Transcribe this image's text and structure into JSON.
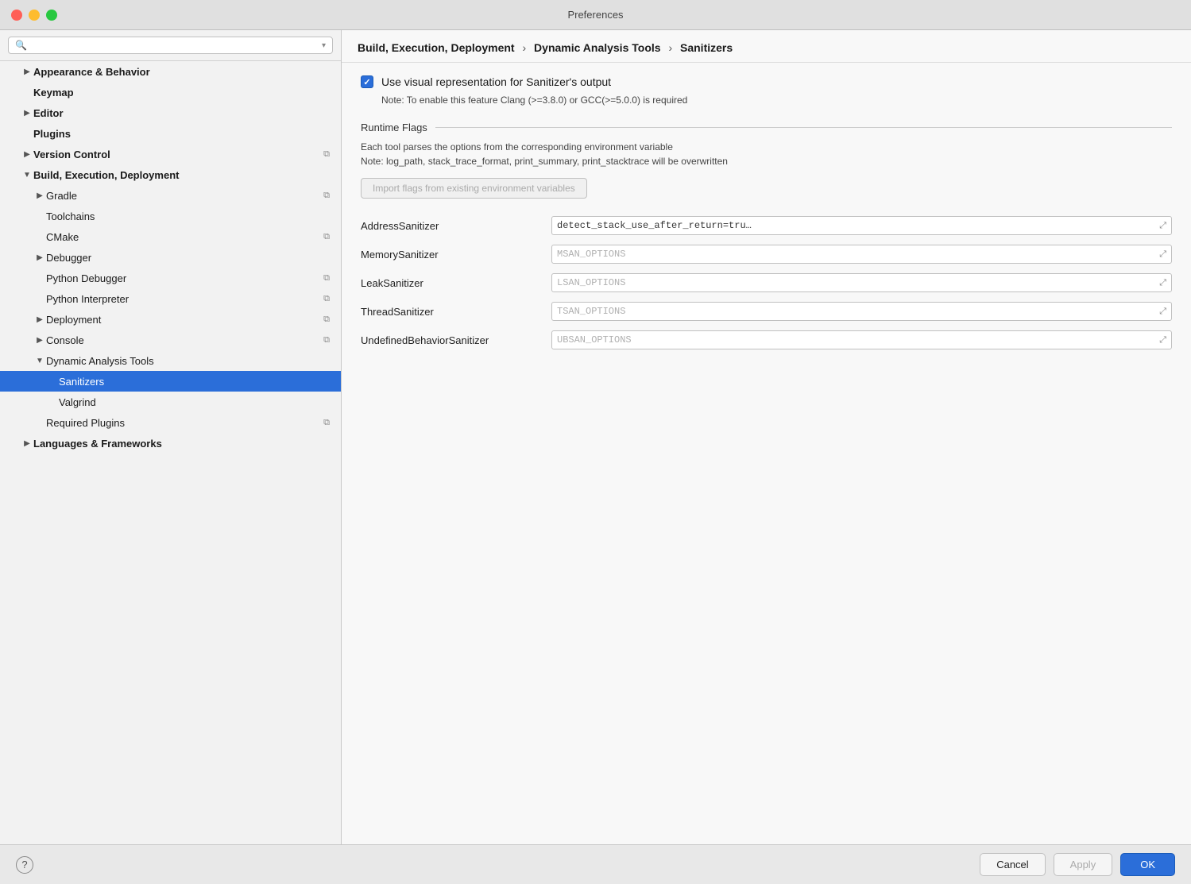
{
  "window": {
    "title": "Preferences",
    "buttons": {
      "close": "close",
      "minimize": "minimize",
      "maximize": "maximize"
    }
  },
  "sidebar": {
    "search_placeholder": "🔍",
    "items": [
      {
        "id": "appearance",
        "label": "Appearance & Behavior",
        "indent": 1,
        "bold": true,
        "chevron": "▶",
        "has_copy": false,
        "expanded": false
      },
      {
        "id": "keymap",
        "label": "Keymap",
        "indent": 1,
        "bold": true,
        "chevron": "",
        "has_copy": false,
        "expanded": false
      },
      {
        "id": "editor",
        "label": "Editor",
        "indent": 1,
        "bold": true,
        "chevron": "▶",
        "has_copy": false,
        "expanded": false
      },
      {
        "id": "plugins",
        "label": "Plugins",
        "indent": 1,
        "bold": true,
        "chevron": "",
        "has_copy": false,
        "expanded": false
      },
      {
        "id": "version-control",
        "label": "Version Control",
        "indent": 1,
        "bold": true,
        "chevron": "▶",
        "has_copy": true,
        "expanded": false
      },
      {
        "id": "build-exec-deploy",
        "label": "Build, Execution, Deployment",
        "indent": 1,
        "bold": true,
        "chevron": "▼",
        "has_copy": false,
        "expanded": true
      },
      {
        "id": "gradle",
        "label": "Gradle",
        "indent": 2,
        "bold": false,
        "chevron": "▶",
        "has_copy": true,
        "expanded": false
      },
      {
        "id": "toolchains",
        "label": "Toolchains",
        "indent": 2,
        "bold": false,
        "chevron": "",
        "has_copy": false,
        "expanded": false
      },
      {
        "id": "cmake",
        "label": "CMake",
        "indent": 2,
        "bold": false,
        "chevron": "",
        "has_copy": true,
        "expanded": false
      },
      {
        "id": "debugger",
        "label": "Debugger",
        "indent": 2,
        "bold": false,
        "chevron": "▶",
        "has_copy": false,
        "expanded": false
      },
      {
        "id": "python-debugger",
        "label": "Python Debugger",
        "indent": 2,
        "bold": false,
        "chevron": "",
        "has_copy": true,
        "expanded": false
      },
      {
        "id": "python-interpreter",
        "label": "Python Interpreter",
        "indent": 2,
        "bold": false,
        "chevron": "",
        "has_copy": true,
        "expanded": false
      },
      {
        "id": "deployment",
        "label": "Deployment",
        "indent": 2,
        "bold": false,
        "chevron": "▶",
        "has_copy": true,
        "expanded": false
      },
      {
        "id": "console",
        "label": "Console",
        "indent": 2,
        "bold": false,
        "chevron": "▶",
        "has_copy": true,
        "expanded": false
      },
      {
        "id": "dynamic-analysis-tools",
        "label": "Dynamic Analysis Tools",
        "indent": 2,
        "bold": false,
        "chevron": "▼",
        "has_copy": false,
        "expanded": true
      },
      {
        "id": "sanitizers",
        "label": "Sanitizers",
        "indent": 3,
        "bold": false,
        "chevron": "",
        "has_copy": false,
        "selected": true
      },
      {
        "id": "valgrind",
        "label": "Valgrind",
        "indent": 3,
        "bold": false,
        "chevron": "",
        "has_copy": false
      },
      {
        "id": "required-plugins",
        "label": "Required Plugins",
        "indent": 2,
        "bold": false,
        "chevron": "",
        "has_copy": true
      },
      {
        "id": "languages-frameworks",
        "label": "Languages & Frameworks",
        "indent": 1,
        "bold": true,
        "chevron": "▶",
        "has_copy": false
      }
    ]
  },
  "breadcrumb": {
    "parts": [
      "Build, Execution, Deployment",
      "Dynamic Analysis Tools",
      "Sanitizers"
    ],
    "separators": [
      "›",
      "›"
    ]
  },
  "panel": {
    "checkbox_label": "Use visual representation for Sanitizer's output",
    "note": "Note: To enable this feature Clang (>=3.8.0) or GCC(>=5.0.0) is required",
    "section_title": "Runtime Flags",
    "desc1": "Each tool parses the options from the corresponding environment variable",
    "desc2": "Note: log_path, stack_trace_format, print_summary, print_stacktrace will be overwritten",
    "import_btn": "Import flags from existing environment variables",
    "fields": [
      {
        "label": "AddressSanitizer",
        "value": "detect_stack_use_after_return=tru…",
        "placeholder": ""
      },
      {
        "label": "MemorySanitizer",
        "value": "",
        "placeholder": "MSAN_OPTIONS"
      },
      {
        "label": "LeakSanitizer",
        "value": "",
        "placeholder": "LSAN_OPTIONS"
      },
      {
        "label": "ThreadSanitizer",
        "value": "",
        "placeholder": "TSAN_OPTIONS"
      },
      {
        "label": "UndefinedBehaviorSanitizer",
        "value": "",
        "placeholder": "UBSAN_OPTIONS"
      }
    ]
  },
  "bottom": {
    "help": "?",
    "cancel": "Cancel",
    "apply": "Apply",
    "ok": "OK"
  }
}
